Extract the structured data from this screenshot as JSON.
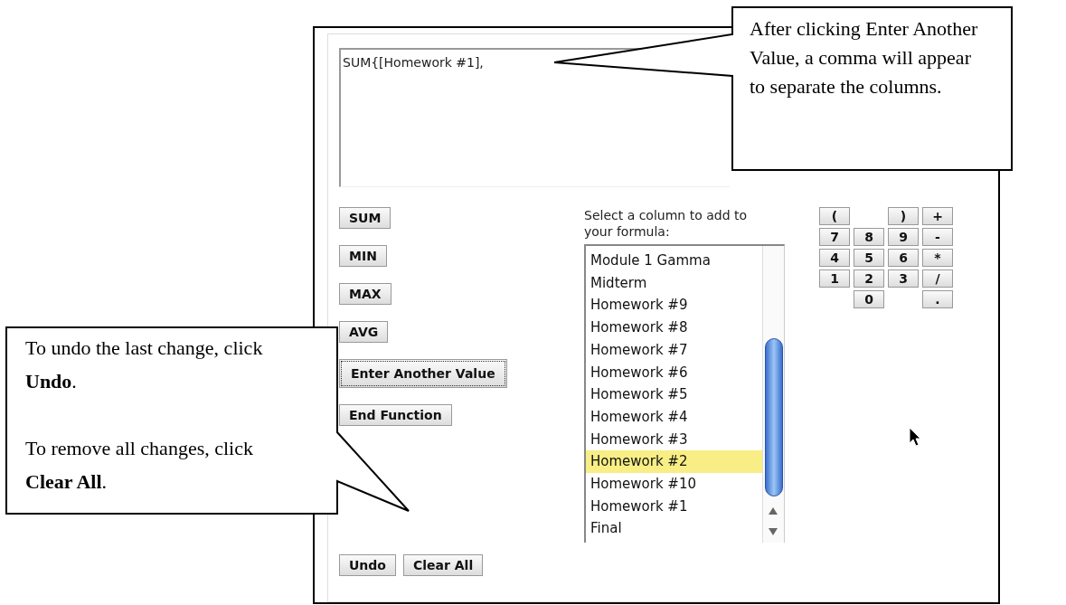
{
  "formula": {
    "value": "SUM{[Homework #1],"
  },
  "function_buttons": [
    {
      "label": "SUM",
      "focused": false
    },
    {
      "label": "MIN",
      "focused": false
    },
    {
      "label": "MAX",
      "focused": false
    },
    {
      "label": "AVG",
      "focused": false
    },
    {
      "label": "Enter Another Value",
      "focused": true
    },
    {
      "label": "End Function",
      "focused": false
    }
  ],
  "column_picker": {
    "label": "Select a column to add to your formula:",
    "items": [
      {
        "label": "Module 1 Gamma",
        "selected": false
      },
      {
        "label": "Midterm",
        "selected": false
      },
      {
        "label": "Homework #9",
        "selected": false
      },
      {
        "label": "Homework #8",
        "selected": false
      },
      {
        "label": "Homework #7",
        "selected": false
      },
      {
        "label": "Homework #6",
        "selected": false
      },
      {
        "label": "Homework #5",
        "selected": false
      },
      {
        "label": "Homework #4",
        "selected": false
      },
      {
        "label": "Homework #3",
        "selected": false
      },
      {
        "label": "Homework #2",
        "selected": true
      },
      {
        "label": "Homework #10",
        "selected": false
      },
      {
        "label": "Homework #1",
        "selected": false
      },
      {
        "label": "Final",
        "selected": false
      }
    ]
  },
  "keypad": [
    [
      {
        "kind": "key",
        "label": "("
      },
      {
        "kind": "gap"
      },
      {
        "kind": "key",
        "label": ")"
      },
      {
        "kind": "key",
        "label": "+"
      }
    ],
    [
      {
        "kind": "key",
        "label": "7"
      },
      {
        "kind": "key",
        "label": "8"
      },
      {
        "kind": "key",
        "label": "9"
      },
      {
        "kind": "key",
        "label": "-"
      }
    ],
    [
      {
        "kind": "key",
        "label": "4"
      },
      {
        "kind": "key",
        "label": "5"
      },
      {
        "kind": "key",
        "label": "6"
      },
      {
        "kind": "key",
        "label": "*"
      }
    ],
    [
      {
        "kind": "key",
        "label": "1"
      },
      {
        "kind": "key",
        "label": "2"
      },
      {
        "kind": "key",
        "label": "3"
      },
      {
        "kind": "key",
        "label": "/"
      }
    ],
    [
      {
        "kind": "gap"
      },
      {
        "kind": "key",
        "label": "0"
      },
      {
        "kind": "gap"
      },
      {
        "kind": "key",
        "label": "."
      }
    ]
  ],
  "bottom_buttons": [
    "Undo",
    "Clear All"
  ],
  "callouts": [
    {
      "paragraphs": [
        "After clicking Enter Another Value, a comma will appear to separate the columns."
      ]
    },
    {
      "paragraphs": [
        "To undo the last change, click **Undo**.",
        "To remove all changes, click **Clear All**."
      ]
    }
  ]
}
